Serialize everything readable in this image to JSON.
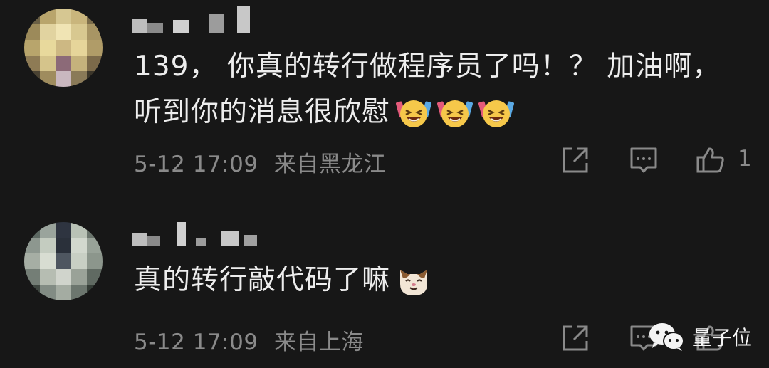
{
  "comments": [
    {
      "text_line1": "139， 你真的转行做程序员了吗！？ 加油啊，",
      "text_line2": "听到你的消息很欣慰",
      "emojis": [
        "laughing-tears-emoji",
        "laughing-tears-emoji",
        "laughing-tears-emoji"
      ],
      "date": "5-12 17:09",
      "location": "来自黑龙江",
      "like_count": "1"
    },
    {
      "text_line1": "真的转行敲代码了嘛",
      "emojis": [
        "cat-face-emoji"
      ],
      "date": "5-12 17:09",
      "location": "来自上海",
      "like_count": ""
    }
  ],
  "watermark": {
    "text": "量子位",
    "icon": "wechat-icon"
  },
  "colors": {
    "background": "#171717",
    "text": "#ededed",
    "meta": "#8a8a8a"
  }
}
